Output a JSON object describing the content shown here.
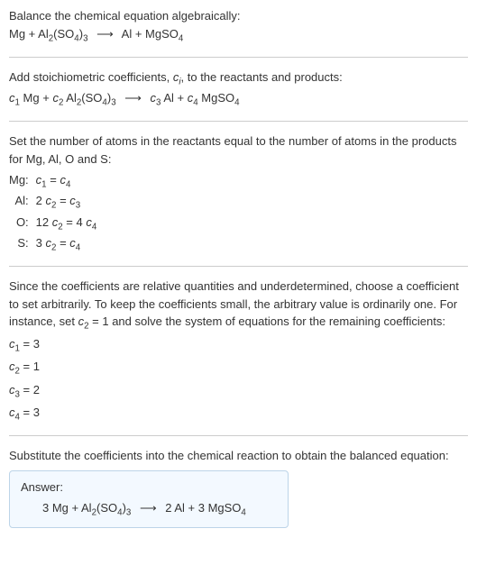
{
  "intro": {
    "line1": "Balance the chemical equation algebraically:",
    "reaction_lhs1": "Mg + Al",
    "reaction_sub1": "2",
    "reaction_lhs2": "(SO",
    "reaction_sub2": "4",
    "reaction_lhs3": ")",
    "reaction_sub3": "3",
    "arrow": "⟶",
    "reaction_rhs1": "Al + MgSO",
    "reaction_sub4": "4"
  },
  "step1": {
    "text": "Add stoichiometric coefficients, ",
    "ci": "c",
    "ci_sub": "i",
    "text2": ", to the reactants and products:",
    "eq_c1": "c",
    "eq_c1s": "1",
    "eq_mg": " Mg + ",
    "eq_c2": "c",
    "eq_c2s": "2",
    "eq_al2": " Al",
    "eq_al2s": "2",
    "eq_so4": "(SO",
    "eq_so4s": "4",
    "eq_close": ")",
    "eq_3s": "3",
    "arrow": "⟶",
    "eq_c3": "c",
    "eq_c3s": "3",
    "eq_al": " Al + ",
    "eq_c4": "c",
    "eq_c4s": "4",
    "eq_mgso4": " MgSO",
    "eq_mgso4s": "4"
  },
  "step2": {
    "text": "Set the number of atoms in the reactants equal to the number of atoms in the products for Mg, Al, O and S:",
    "rows": [
      {
        "label": "Mg:",
        "lhs_coeff": "",
        "lhs_c": "c",
        "lhs_cs": "1",
        "eq": " = ",
        "rhs_coeff": "",
        "rhs_c": "c",
        "rhs_cs": "4"
      },
      {
        "label": "Al:",
        "lhs_coeff": "2 ",
        "lhs_c": "c",
        "lhs_cs": "2",
        "eq": " = ",
        "rhs_coeff": "",
        "rhs_c": "c",
        "rhs_cs": "3"
      },
      {
        "label": "O:",
        "lhs_coeff": "12 ",
        "lhs_c": "c",
        "lhs_cs": "2",
        "eq": " = ",
        "rhs_coeff": "4 ",
        "rhs_c": "c",
        "rhs_cs": "4"
      },
      {
        "label": "S:",
        "lhs_coeff": "3 ",
        "lhs_c": "c",
        "lhs_cs": "2",
        "eq": " = ",
        "rhs_coeff": "",
        "rhs_c": "c",
        "rhs_cs": "4"
      }
    ]
  },
  "step3": {
    "text1": "Since the coefficients are relative quantities and underdetermined, choose a coefficient to set arbitrarily. To keep the coefficients small, the arbitrary value is ordinarily one. For instance, set ",
    "c2": "c",
    "c2s": "2",
    "text2": " = 1 and solve the system of equations for the remaining coefficients:",
    "solutions": [
      {
        "c": "c",
        "cs": "1",
        "val": " = 3"
      },
      {
        "c": "c",
        "cs": "2",
        "val": " = 1"
      },
      {
        "c": "c",
        "cs": "3",
        "val": " = 2"
      },
      {
        "c": "c",
        "cs": "4",
        "val": " = 3"
      }
    ]
  },
  "step4": {
    "text": "Substitute the coefficients into the chemical reaction to obtain the balanced equation:"
  },
  "answer": {
    "label": "Answer:",
    "lhs1": "3 Mg + Al",
    "sub1": "2",
    "lhs2": "(SO",
    "sub2": "4",
    "lhs3": ")",
    "sub3": "3",
    "arrow": "⟶",
    "rhs1": "2 Al + 3 MgSO",
    "sub4": "4"
  },
  "chart_data": {
    "type": "table",
    "title": "Balanced chemical equation: 3 Mg + Al2(SO4)3 -> 2 Al + 3 MgSO4",
    "atom_balance": [
      {
        "element": "Mg",
        "equation": "c1 = c4"
      },
      {
        "element": "Al",
        "equation": "2 c2 = c3"
      },
      {
        "element": "O",
        "equation": "12 c2 = 4 c4"
      },
      {
        "element": "S",
        "equation": "3 c2 = c4"
      }
    ],
    "coefficients": {
      "c1": 3,
      "c2": 1,
      "c3": 2,
      "c4": 3
    }
  }
}
